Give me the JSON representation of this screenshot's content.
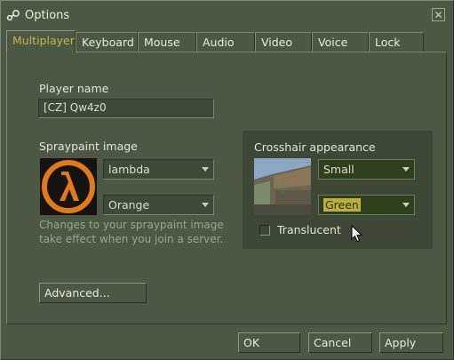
{
  "window": {
    "title": "Options",
    "icon": "steam-icon",
    "close_icon": "close-icon"
  },
  "tabs": [
    {
      "label": "Multiplayer",
      "active": true
    },
    {
      "label": "Keyboard"
    },
    {
      "label": "Mouse"
    },
    {
      "label": "Audio"
    },
    {
      "label": "Video"
    },
    {
      "label": "Voice"
    },
    {
      "label": "Lock"
    }
  ],
  "multiplayer": {
    "player_name_label": "Player name",
    "player_name_value": "[CZ] Qw4z0",
    "spraypaint_label": "Spraypaint image",
    "spray_image_select": "lambda",
    "spray_color_select": "Orange",
    "spray_hint": "Changes to your spraypaint image take effect when you join a server.",
    "advanced_button": "Advanced...",
    "crosshair": {
      "label": "Crosshair appearance",
      "size_select": "Small",
      "color_select": "Green",
      "translucent_label": "Translucent",
      "translucent_checked": false
    }
  },
  "footer": {
    "ok": "OK",
    "cancel": "Cancel",
    "apply": "Apply"
  },
  "colors": {
    "background": "#4c5844",
    "accent_text": "#c4b44a",
    "highlight": "#bdb03a",
    "spray_orange": "#e07a1a"
  }
}
